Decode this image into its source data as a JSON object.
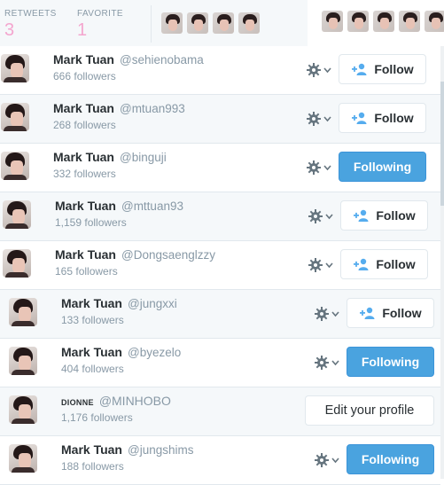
{
  "stats": {
    "retweets": {
      "label": "RETWEETS",
      "value": "3"
    },
    "favorites": {
      "label": "FAVORITE",
      "value": "1"
    }
  },
  "colors": {
    "accent_pink": "#f4a6cf",
    "following_blue": "#4aa3df",
    "icon_blue": "#55acee",
    "muted_text": "#8899a6"
  },
  "rows": [
    {
      "name": "Mark Tuan",
      "handle": "@sehienobama",
      "followers": "666 followers",
      "button": "Follow"
    },
    {
      "name": "Mark Tuan",
      "handle": "@mtuan993",
      "followers": "268 followers",
      "button": "Follow"
    },
    {
      "name": "Mark Tuan",
      "handle": "@binguji",
      "followers": "332 followers",
      "button": "Following"
    },
    {
      "name": "Mark Tuan",
      "handle": "@mttuan93",
      "followers": "1,159 followers",
      "button": "Follow"
    },
    {
      "name": "Mark Tuan",
      "handle": "@Dongsaenglzzy",
      "followers": "165 followers",
      "button": "Follow"
    },
    {
      "name": "Mark Tuan",
      "handle": "@jungxxi",
      "followers": "133 followers",
      "button": "Follow"
    },
    {
      "name": "Mark Tuan",
      "handle": "@byezelo",
      "followers": "404 followers",
      "button": "Following"
    },
    {
      "name": "DIONNE",
      "handle": "@MINHOBO",
      "followers": "1,176 followers",
      "button": "Edit your profile"
    },
    {
      "name": "Mark Tuan",
      "handle": "@jungshims",
      "followers": "188 followers",
      "button": "Following"
    }
  ],
  "icons": {
    "settings": "gear-icon",
    "dropdown": "chevron-down-icon",
    "follow": "add-user-icon"
  }
}
